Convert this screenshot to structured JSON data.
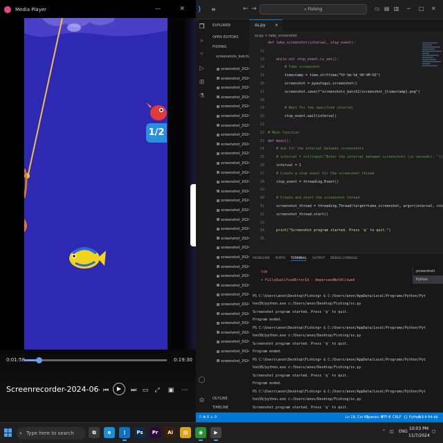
{
  "media_player": {
    "title": "Media Player",
    "elapsed": "0:01:58",
    "duration": "0:19:30",
    "progress": 0.1,
    "filename": "Screenrecorder-2024-06-27-13-3...",
    "game": {
      "badge_text": "1/2",
      "right_fragments": [
        "G",
        "-",
        "BB",
        "XB",
        "o",
        "UB",
        "B",
        "BB",
        "_o",
        "7B",
        "B",
        "_B",
        "B",
        "B.",
        "-B",
        "0"
      ]
    }
  },
  "vscode": {
    "search_text": "Fishing",
    "tab_label": "ss.py",
    "breadcrumb": "ss.py > take_screenshot",
    "explorer": {
      "header": "EXPLORER",
      "open_editors": "OPEN EDITORS",
      "folder": "FISHING",
      "subfolder": "screenshots_batch2",
      "file_label": "screenshot_2024-07...",
      "outline": "OUTLINE",
      "timeline": "TIMELINE"
    },
    "code_lines": [
      {
        "n": "",
        "t": "def take_screenshot(interval, stop_event):"
      },
      {
        "n": "12",
        "t": ""
      },
      {
        "n": "13",
        "t": "    while not stop_event.is_set():"
      },
      {
        "n": "14",
        "t": "        # Take screenshot"
      },
      {
        "n": "15",
        "t": "        timestamp = time.strftime(\"%Y-%m-%d_%H-%M-%S\")"
      },
      {
        "n": "16",
        "t": "        screenshot = pyautogui.screenshot()"
      },
      {
        "n": "17",
        "t": "        screenshot.save(f\"screenshots_batch2/screenshot_{timestamp}.png\")"
      },
      {
        "n": "18",
        "t": ""
      },
      {
        "n": "19",
        "t": "        # Wait for the specified interval"
      },
      {
        "n": "20",
        "t": "        stop_event.wait(interval)"
      },
      {
        "n": "21",
        "t": ""
      },
      {
        "n": "22",
        "t": "# Main function"
      },
      {
        "n": "23",
        "t": "def main():"
      },
      {
        "n": "24",
        "t": "    # Ask for the interval between screenshots"
      },
      {
        "n": "25",
        "t": "    # interval = int(input(\"Enter the interval between screenshots (in seconds): \"))"
      },
      {
        "n": "26",
        "t": "    interval = 1"
      },
      {
        "n": "27",
        "t": "    # Create a stop event for the screenshot thread"
      },
      {
        "n": "28",
        "t": "    stop_event = threading.Event()"
      },
      {
        "n": "29",
        "t": ""
      },
      {
        "n": "30",
        "t": "    # Create and start the screenshot thread"
      },
      {
        "n": "31",
        "t": "    screenshot_thread = threading.Thread(target=take_screenshot, args=(interval, stop_"
      },
      {
        "n": "32",
        "t": "    screenshot_thread.start()"
      },
      {
        "n": "33",
        "t": ""
      },
      {
        "n": "34",
        "t": "    print(\"Screenshot program started. Press 'q' to quit.\")"
      },
      {
        "n": "35",
        "t": ""
      }
    ],
    "panel_tabs": [
      "PROBLEMS",
      "PORTS",
      "TERMINAL",
      "OUTPUT",
      "DEBUG CONSOLE"
    ],
    "terminal_lines": [
      {
        "t": "    tim",
        "c": "#f48771"
      },
      {
        "t": "    + FullyQualifiedErrorId : AmpersandNotAllowed",
        "c": "#f48771"
      },
      {
        "t": "",
        "c": "#ccc"
      },
      {
        "t": "PS C:\\Users\\anon\\Desktop\\Fishing> & C:/Users/anon/AppData/Local/Programs/Python/Pyt",
        "c": "#ccc"
      },
      {
        "t": "hon39/python.exe c:/Users/anon/Desktop/Fishing/ss.py",
        "c": "#ccc"
      },
      {
        "t": "Screenshot program started. Press 'q' to quit.",
        "c": "#ccc"
      },
      {
        "t": "Program ended.",
        "c": "#ccc"
      },
      {
        "t": "PS C:\\Users\\anon\\Desktop\\Fishing> & C:/Users/anon/AppData/Local/Programs/Python/Pyt",
        "c": "#ccc"
      },
      {
        "t": "hon39/python.exe c:/Users/anon/Desktop/Fishing/ss.py",
        "c": "#ccc"
      },
      {
        "t": "Screenshot program started. Press 'q' to quit.",
        "c": "#ccc"
      },
      {
        "t": "Program ended.",
        "c": "#ccc"
      },
      {
        "t": "PS C:\\Users\\anon\\Desktop\\Fishing> & C:/Users/anon/AppData/Local/Programs/Python/Pyt",
        "c": "#ccc"
      },
      {
        "t": "hon39/python.exe c:/Users/anon/Desktop/Fishing/ss.py",
        "c": "#ccc"
      },
      {
        "t": "Screenshot program started. Press 'q' to quit.",
        "c": "#ccc"
      },
      {
        "t": "Program ended.",
        "c": "#ccc"
      },
      {
        "t": "PS C:\\Users\\anon\\Desktop\\Fishing> & C:/Users/anon/AppData/Local/Programs/Python/Pyt",
        "c": "#ccc"
      },
      {
        "t": "hon39/python.exe c:/Users/anon/Desktop/Fishing/ss.py",
        "c": "#ccc"
      },
      {
        "t": "Screenshot program started. Press 'q' to quit.",
        "c": "#ccc"
      }
    ],
    "terminal_list": [
      "powershell",
      "Python"
    ],
    "status": {
      "left": "⚇ ⊗ 0 ⚠ 0",
      "position": "Ln 19, Col 42",
      "spaces": "Spaces: 4",
      "encoding": "UTF-8",
      "eol": "CRLF",
      "language": "{} Python",
      "interpreter": "3.9.4 64-bit"
    }
  },
  "taskbar": {
    "search_placeholder": "Type here to search",
    "apps": [
      {
        "name": "task-view",
        "label": "⧉",
        "color": "#3a3a3a"
      },
      {
        "name": "edge",
        "label": "e",
        "color": "#1b8fd8"
      },
      {
        "name": "vscode",
        "label": "⟩",
        "color": "#0e72c2"
      },
      {
        "name": "photoshop",
        "label": "Ps",
        "color": "#0c2b4f"
      },
      {
        "name": "premiere",
        "label": "Pr",
        "color": "#2a0a3d"
      },
      {
        "name": "illustrator",
        "label": "Ai",
        "color": "#3d1f00"
      },
      {
        "name": "files",
        "label": "▤",
        "color": "#d9a520"
      },
      {
        "name": "chrome",
        "label": "◉",
        "color": "#2b8f3a"
      },
      {
        "name": "media",
        "label": "▶",
        "color": "#444"
      }
    ],
    "lang": "ENG",
    "time": "10:03 PM",
    "date": "11/7/2024"
  },
  "colors": {
    "accent": "#0078d4",
    "video_bg": "#2e29b3"
  }
}
